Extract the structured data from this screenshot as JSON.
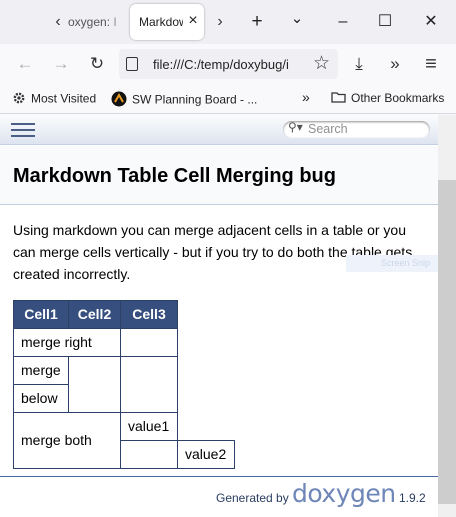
{
  "browser": {
    "tabs": [
      {
        "label": "oxygen: I",
        "active": false
      },
      {
        "label": "Markdow",
        "active": true
      }
    ],
    "url": "file:///C:/temp/doxybug/i",
    "bookmarks": [
      "Most Visited",
      "SW Planning Board - ...",
      "Other Bookmarks"
    ],
    "icons": {
      "tab_scroll_left": "‹",
      "tab_scroll_right": "›",
      "close": "×",
      "new_tab": "+",
      "list_all_tabs": "⌄",
      "minimize": "–",
      "maximize": "☐",
      "window_close": "✕",
      "back": "←",
      "forward": "→",
      "reload": "↻",
      "star": "☆",
      "downloads": "⤓",
      "overflow": "»",
      "menu": "≡",
      "bookmarks_overflow": "»"
    }
  },
  "doxygen": {
    "search_placeholder": "Search",
    "title": "Markdown Table Cell Merging bug",
    "description": "Using markdown you can merge adjacent cells in a table or you can merge cells vertically - but if you try to do both the table gets created incorrectly.",
    "overlay_text": "Screen Snip",
    "table": {
      "headers": [
        "Cell1",
        "Cell2",
        "Cell3"
      ],
      "cells": {
        "merge_right": "merge right",
        "merge": "merge",
        "below": "below",
        "merge_both": "merge both",
        "value1": "value1",
        "value2": "value2"
      }
    },
    "footer": {
      "generated_by": "Generated by",
      "logo": "doxygen",
      "version": "1.9.2"
    },
    "colors": {
      "header_bg": "#374f7f",
      "border": "#2d4068",
      "footer_line": "#4a6aaa",
      "logo": "#6f86b8"
    }
  }
}
